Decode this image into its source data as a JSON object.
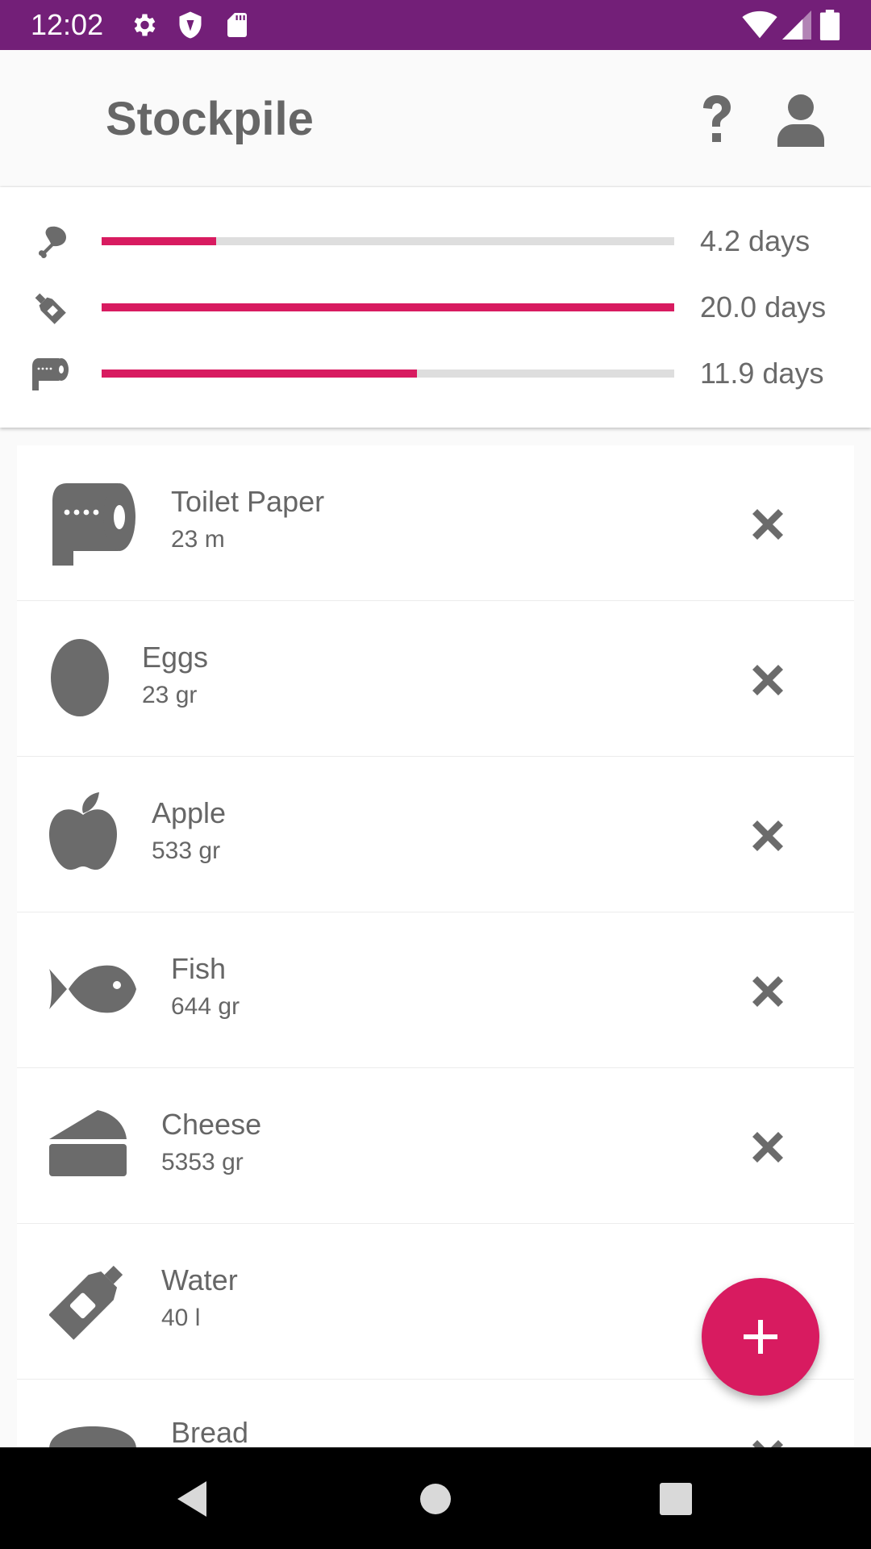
{
  "status_bar": {
    "time": "12:02",
    "icons": [
      "gear-icon",
      "shield-icon",
      "sd-card-icon",
      "wifi-icon",
      "signal-icon",
      "battery-icon"
    ],
    "background": "#731f78"
  },
  "app_bar": {
    "title": "Stockpile",
    "actions": [
      "help-icon",
      "account-icon"
    ]
  },
  "summary": [
    {
      "icon": "drumstick-icon",
      "fraction": 0.2,
      "text": "4.2 days"
    },
    {
      "icon": "bottle-icon",
      "fraction": 1.0,
      "text": "20.0 days"
    },
    {
      "icon": "toilet-paper-icon",
      "fraction": 0.55,
      "text": "11.9 days"
    }
  ],
  "items": [
    {
      "name": "Toilet Paper",
      "qty": "23 m",
      "icon": "toilet-paper-icon"
    },
    {
      "name": "Eggs",
      "qty": "23 gr",
      "icon": "egg-icon"
    },
    {
      "name": "Apple",
      "qty": "533 gr",
      "icon": "apple-icon"
    },
    {
      "name": "Fish",
      "qty": "644 gr",
      "icon": "fish-icon"
    },
    {
      "name": "Cheese",
      "qty": "5353 gr",
      "icon": "cheese-icon"
    },
    {
      "name": "Water",
      "qty": "40 l",
      "icon": "bottle-icon"
    },
    {
      "name": "Bread",
      "qty": "",
      "icon": "bread-icon"
    }
  ],
  "fab": {
    "icon": "plus-icon"
  },
  "nav_bar": {
    "buttons": [
      "back-icon",
      "home-icon",
      "recents-icon"
    ]
  },
  "colors": {
    "accent": "#d81b60",
    "icon_gray": "#6b6b6b",
    "track": "#dedede"
  }
}
